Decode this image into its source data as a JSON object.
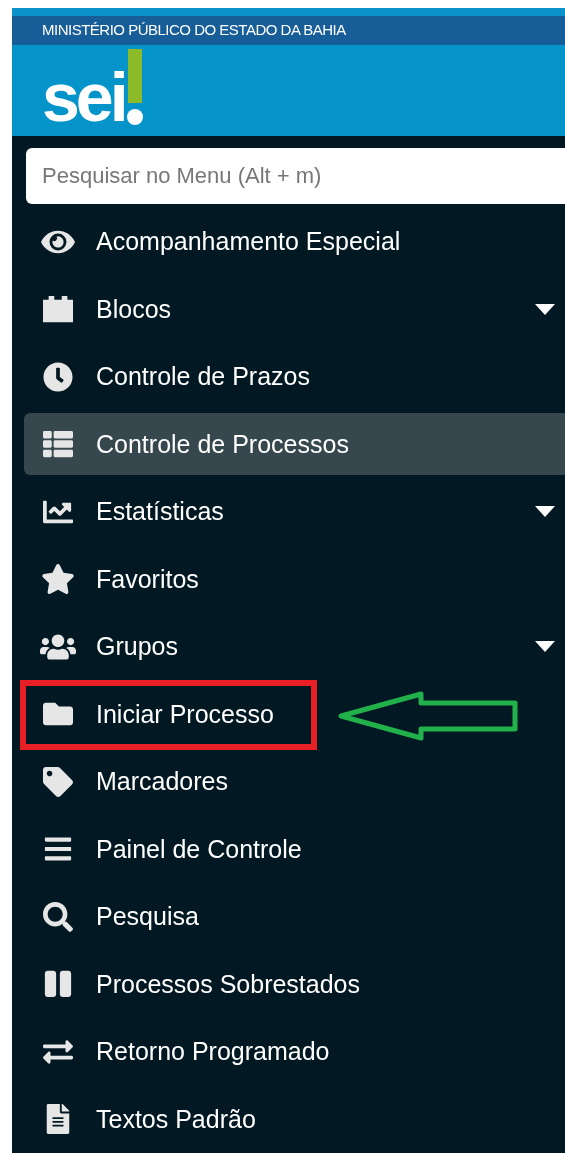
{
  "header": {
    "organization": "MINISTÉRIO PÚBLICO DO ESTADO DA BAHIA",
    "logo": "sei"
  },
  "search": {
    "placeholder": "Pesquisar no Menu (Alt + m)"
  },
  "menu": [
    {
      "label": "Acompanhamento Especial",
      "selected": false,
      "submenu": false,
      "annotated": false
    },
    {
      "label": "Blocos",
      "selected": false,
      "submenu": true,
      "annotated": false
    },
    {
      "label": "Controle de Prazos",
      "selected": false,
      "submenu": false,
      "annotated": false
    },
    {
      "label": "Controle de Processos",
      "selected": true,
      "submenu": false,
      "annotated": false
    },
    {
      "label": "Estatísticas",
      "selected": false,
      "submenu": true,
      "annotated": false
    },
    {
      "label": "Favoritos",
      "selected": false,
      "submenu": false,
      "annotated": false
    },
    {
      "label": "Grupos",
      "selected": false,
      "submenu": true,
      "annotated": false
    },
    {
      "label": "Iniciar Processo",
      "selected": false,
      "submenu": false,
      "annotated": true
    },
    {
      "label": "Marcadores",
      "selected": false,
      "submenu": false,
      "annotated": false
    },
    {
      "label": "Painel de Controle",
      "selected": false,
      "submenu": false,
      "annotated": false
    },
    {
      "label": "Pesquisa",
      "selected": false,
      "submenu": false,
      "annotated": false
    },
    {
      "label": "Processos Sobrestados",
      "selected": false,
      "submenu": false,
      "annotated": false
    },
    {
      "label": "Retorno Programado",
      "selected": false,
      "submenu": false,
      "annotated": false
    },
    {
      "label": "Textos Padrão",
      "selected": false,
      "submenu": false,
      "annotated": false
    }
  ]
}
